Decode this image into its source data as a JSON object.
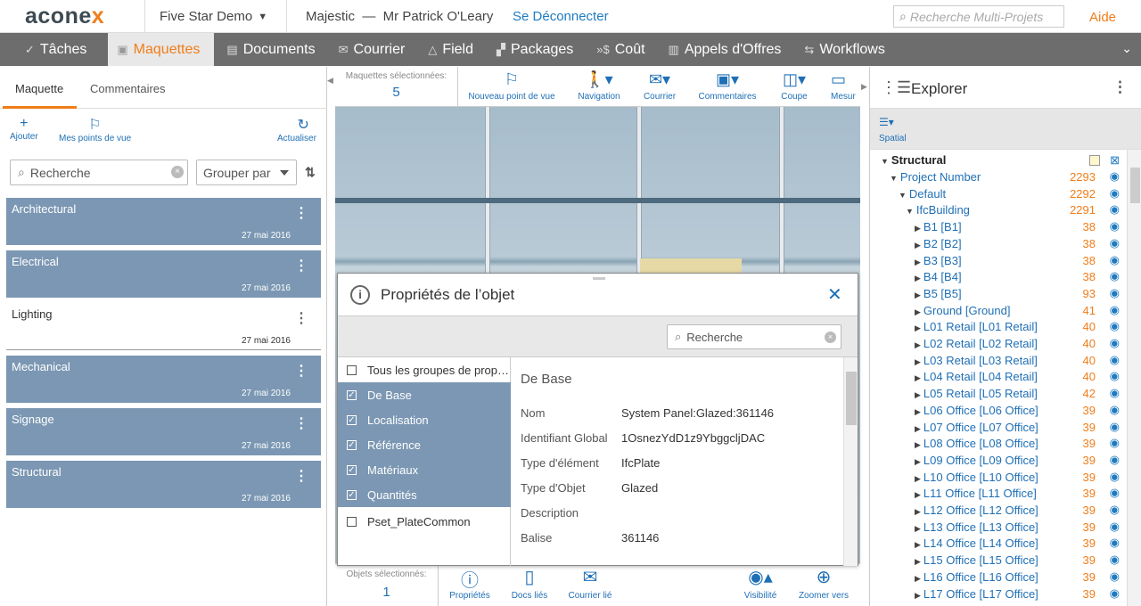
{
  "header": {
    "logo_main": "acone",
    "logo_x": "x",
    "project": "Five Star Demo",
    "user": "Majestic  —  Mr Patrick O'Leary",
    "logout": "Se Déconnecter",
    "search_placeholder": "Recherche Multi-Projets",
    "help": "Aide"
  },
  "nav": [
    {
      "label": "Tâches",
      "icon": "check-icon",
      "glyph": "✓"
    },
    {
      "label": "Maquettes",
      "icon": "cube-icon",
      "glyph": "▣",
      "active": true
    },
    {
      "label": "Documents",
      "icon": "document-icon",
      "glyph": "▤"
    },
    {
      "label": "Courrier",
      "icon": "mail-icon",
      "glyph": "✉"
    },
    {
      "label": "Field",
      "icon": "field-icon",
      "glyph": "△"
    },
    {
      "label": "Packages",
      "icon": "packages-icon",
      "glyph": "▞"
    },
    {
      "label": "Coût",
      "icon": "cost-icon",
      "glyph": "»$"
    },
    {
      "label": "Appels d'Offres",
      "icon": "tender-icon",
      "glyph": "▥"
    },
    {
      "label": "Workflows",
      "icon": "workflow-icon",
      "glyph": "⇆"
    }
  ],
  "left": {
    "tabs": [
      "Maquette",
      "Commentaires"
    ],
    "tools": {
      "add": "Ajouter",
      "views": "Mes points de vue",
      "refresh": "Actualiser"
    },
    "search_placeholder": "Recherche",
    "group_by": "Grouper par",
    "models": [
      {
        "name": "Architectural",
        "date": "27 mai 2016",
        "selected": true
      },
      {
        "name": "Electrical",
        "date": "27 mai 2016",
        "selected": true
      },
      {
        "name": "Lighting",
        "date": "27 mai 2016",
        "selected": false
      },
      {
        "name": "Mechanical",
        "date": "27 mai 2016",
        "selected": true
      },
      {
        "name": "Signage",
        "date": "27 mai 2016",
        "selected": true
      },
      {
        "name": "Structural",
        "date": "27 mai 2016",
        "selected": true
      }
    ]
  },
  "viewer": {
    "models_selected_label": "Maquettes sélectionnées:",
    "models_selected_count": "5",
    "tools": [
      "Nouveau point de vue",
      "Navigation",
      "Courrier",
      "Commentaires",
      "Coupe",
      "Mesur"
    ],
    "objects_selected_label": "Objets sélectionnés:",
    "objects_selected_count": "1",
    "bottom_tools": [
      "Propriétés",
      "Docs liés",
      "Courrier lié",
      "Visibilité",
      "Zoomer vers"
    ]
  },
  "props": {
    "title": "Propriétés de l’objet",
    "search_placeholder": "Recherche",
    "groups": [
      {
        "label": "Tous les groupes de prop…",
        "checked": false
      },
      {
        "label": "De Base",
        "checked": true
      },
      {
        "label": "Localisation",
        "checked": true
      },
      {
        "label": "Référence",
        "checked": true
      },
      {
        "label": "Matériaux",
        "checked": true
      },
      {
        "label": "Quantités",
        "checked": true
      },
      {
        "label": "Pset_PlateCommon",
        "checked": false
      }
    ],
    "section": "De Base",
    "rows": [
      {
        "k": "Nom",
        "v": "System Panel:Glazed:361146"
      },
      {
        "k": "Identifiant Global",
        "v": "1OsnezYdD1z9YbggcljDAC"
      },
      {
        "k": "Type d'élément",
        "v": "IfcPlate"
      },
      {
        "k": "Type d'Objet",
        "v": "Glazed"
      },
      {
        "k": "Description",
        "v": ""
      },
      {
        "k": "Balise",
        "v": "361146"
      }
    ]
  },
  "explorer": {
    "title": "Explorer",
    "spatial": "Spatial",
    "root": "Structural",
    "tree": [
      {
        "label": "Project Number",
        "count": "2293",
        "level": 1,
        "open": true
      },
      {
        "label": "Default",
        "count": "2292",
        "level": 2,
        "open": true
      },
      {
        "label": "IfcBuilding",
        "count": "2291",
        "level": 3,
        "open": true
      },
      {
        "label": "B1 [B1]",
        "count": "38",
        "level": 4
      },
      {
        "label": "B2 [B2]",
        "count": "38",
        "level": 4
      },
      {
        "label": "B3 [B3]",
        "count": "38",
        "level": 4
      },
      {
        "label": "B4 [B4]",
        "count": "38",
        "level": 4
      },
      {
        "label": "B5 [B5]",
        "count": "93",
        "level": 4
      },
      {
        "label": "Ground [Ground]",
        "count": "41",
        "level": 4
      },
      {
        "label": "L01 Retail [L01 Retail]",
        "count": "40",
        "level": 4
      },
      {
        "label": "L02 Retail [L02 Retail]",
        "count": "40",
        "level": 4
      },
      {
        "label": "L03 Retail [L03 Retail]",
        "count": "40",
        "level": 4
      },
      {
        "label": "L04 Retail [L04 Retail]",
        "count": "40",
        "level": 4
      },
      {
        "label": "L05 Retail [L05 Retail]",
        "count": "42",
        "level": 4
      },
      {
        "label": "L06 Office [L06 Office]",
        "count": "39",
        "level": 4
      },
      {
        "label": "L07 Office [L07 Office]",
        "count": "39",
        "level": 4
      },
      {
        "label": "L08 Office [L08 Office]",
        "count": "39",
        "level": 4
      },
      {
        "label": "L09 Office [L09 Office]",
        "count": "39",
        "level": 4
      },
      {
        "label": "L10 Office [L10 Office]",
        "count": "39",
        "level": 4
      },
      {
        "label": "L11 Office [L11 Office]",
        "count": "39",
        "level": 4
      },
      {
        "label": "L12 Office [L12 Office]",
        "count": "39",
        "level": 4
      },
      {
        "label": "L13 Office [L13 Office]",
        "count": "39",
        "level": 4
      },
      {
        "label": "L14 Office [L14 Office]",
        "count": "39",
        "level": 4
      },
      {
        "label": "L15 Office [L15 Office]",
        "count": "39",
        "level": 4
      },
      {
        "label": "L16 Office [L16 Office]",
        "count": "39",
        "level": 4
      },
      {
        "label": "L17 Office [L17 Office]",
        "count": "39",
        "level": 4
      }
    ]
  },
  "colors": {
    "accent": "#f07d1a",
    "link": "#1f6fb5",
    "selected": "#7b97b3",
    "nav": "#6d6d6d"
  }
}
